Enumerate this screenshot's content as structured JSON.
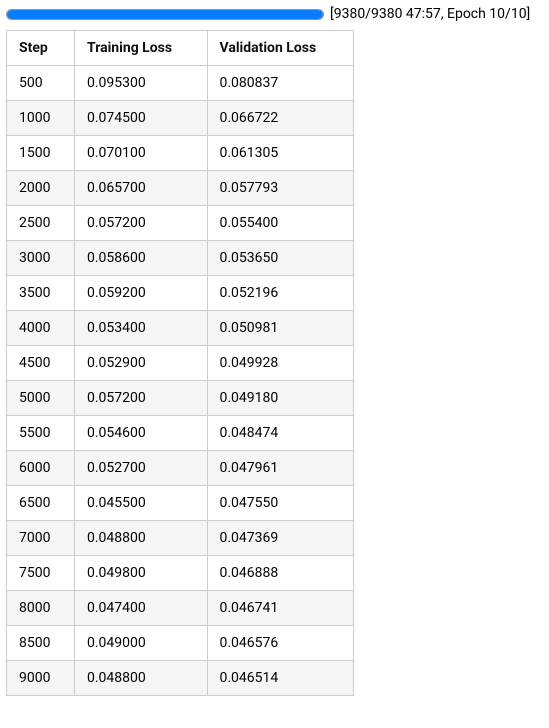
{
  "progress": {
    "label": "[9380/9380 47:57, Epoch 10/10]",
    "percent": 100
  },
  "headers": {
    "step": "Step",
    "train": "Training Loss",
    "valid": "Validation Loss"
  },
  "chart_data": {
    "type": "table",
    "title": "Training progress loss table",
    "columns": [
      "Step",
      "Training Loss",
      "Validation Loss"
    ],
    "rows": [
      {
        "step": "500",
        "training_loss": "0.095300",
        "validation_loss": "0.080837"
      },
      {
        "step": "1000",
        "training_loss": "0.074500",
        "validation_loss": "0.066722"
      },
      {
        "step": "1500",
        "training_loss": "0.070100",
        "validation_loss": "0.061305"
      },
      {
        "step": "2000",
        "training_loss": "0.065700",
        "validation_loss": "0.057793"
      },
      {
        "step": "2500",
        "training_loss": "0.057200",
        "validation_loss": "0.055400"
      },
      {
        "step": "3000",
        "training_loss": "0.058600",
        "validation_loss": "0.053650"
      },
      {
        "step": "3500",
        "training_loss": "0.059200",
        "validation_loss": "0.052196"
      },
      {
        "step": "4000",
        "training_loss": "0.053400",
        "validation_loss": "0.050981"
      },
      {
        "step": "4500",
        "training_loss": "0.052900",
        "validation_loss": "0.049928"
      },
      {
        "step": "5000",
        "training_loss": "0.057200",
        "validation_loss": "0.049180"
      },
      {
        "step": "5500",
        "training_loss": "0.054600",
        "validation_loss": "0.048474"
      },
      {
        "step": "6000",
        "training_loss": "0.052700",
        "validation_loss": "0.047961"
      },
      {
        "step": "6500",
        "training_loss": "0.045500",
        "validation_loss": "0.047550"
      },
      {
        "step": "7000",
        "training_loss": "0.048800",
        "validation_loss": "0.047369"
      },
      {
        "step": "7500",
        "training_loss": "0.049800",
        "validation_loss": "0.046888"
      },
      {
        "step": "8000",
        "training_loss": "0.047400",
        "validation_loss": "0.046741"
      },
      {
        "step": "8500",
        "training_loss": "0.049000",
        "validation_loss": "0.046576"
      },
      {
        "step": "9000",
        "training_loss": "0.048800",
        "validation_loss": "0.046514"
      }
    ]
  }
}
